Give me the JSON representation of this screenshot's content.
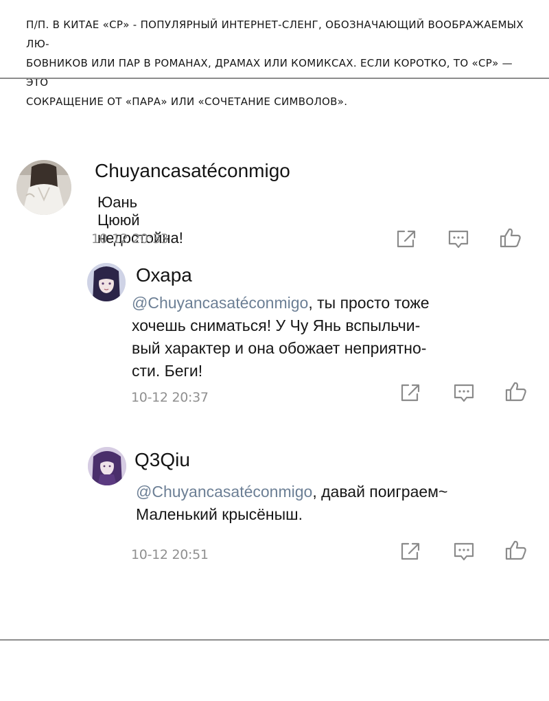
{
  "note": {
    "line1": "п/п. в Китае «CP» - популярный интернет-сленг, обозначающий воображаемых лю-",
    "line2": "бовников или пар в романах, драмах или комиксах. Если коротко, то «CP» — это",
    "line3": "сокращение от «пара» или «сочетание символов»."
  },
  "comments": [
    {
      "username": "Chuyancasatéconmigo",
      "text": "Юань Цююй недостойна!",
      "time": "10-12  20:33"
    },
    {
      "username": "Охара",
      "mention": "@Chuyancasatéconmigo",
      "text_after_mention": ", ты просто тоже",
      "lines": [
        "хочешь сниматься! У Чу Янь вспыльчи-",
        "вый характер и она обожает неприятно-",
        "сти. Беги!"
      ],
      "time": "10-12  20:37"
    },
    {
      "username": "Q3Qiu",
      "mention": "@Chuyancasatéconmigo",
      "text_after_mention": ", давай поиграем~",
      "lines": [
        "Маленький крысёныш."
      ],
      "time": "10-12  20:51"
    }
  ],
  "icons": {
    "share": "share-icon",
    "reply": "comment-icon",
    "like": "thumbs-up-icon"
  },
  "colors": {
    "mention": "#6c7f95",
    "timestamp": "#8f8f8f",
    "icon_stroke": "#8a8a8a",
    "rule": "#8c8c8c"
  }
}
